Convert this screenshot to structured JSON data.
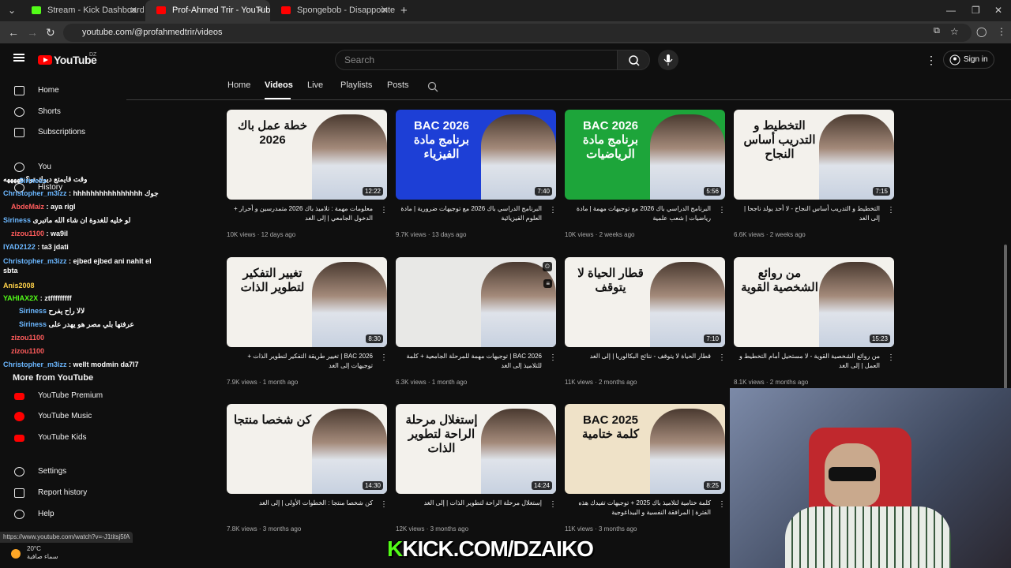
{
  "browser": {
    "tabs": [
      {
        "title": "Stream - Kick Dashboard",
        "color": "#53fc18",
        "active": false
      },
      {
        "title": "Prof-Ahmed Trir - YouTube",
        "color": "#ff0000",
        "active": true
      },
      {
        "title": "Spongebob - Disappointed So",
        "color": "#ff0000",
        "active": false
      }
    ],
    "url": "youtube.com/@profahmedtrir/videos",
    "new_tab": "+",
    "tab_close": "✕"
  },
  "header": {
    "logo": "YouTube",
    "country": "DZ",
    "search_placeholder": "Search",
    "sign_in": "Sign in"
  },
  "sidebar": {
    "items": [
      {
        "label": "Home",
        "icon": "home-icon"
      },
      {
        "label": "Shorts",
        "icon": "shorts-icon"
      },
      {
        "label": "Subscriptions",
        "icon": "subscriptions-icon"
      },
      {
        "label": "You",
        "icon": "you-icon"
      },
      {
        "label": "History",
        "icon": "history-icon"
      }
    ],
    "more_title": "More from YouTube",
    "more": [
      {
        "label": "YouTube Premium",
        "icon": "youtube-premium-icon"
      },
      {
        "label": "YouTube Music",
        "icon": "youtube-music-icon"
      },
      {
        "label": "YouTube Kids",
        "icon": "youtube-kids-icon"
      }
    ],
    "footer": [
      {
        "label": "Settings",
        "icon": "settings-icon"
      },
      {
        "label": "Report history",
        "icon": "flag-icon"
      },
      {
        "label": "Help",
        "icon": "help-icon"
      }
    ]
  },
  "chat": [
    {
      "user": "",
      "msg": "وقت قايمتع ديوك تو؟ هههههه"
    },
    {
      "user": "Siriness",
      "msg": ""
    },
    {
      "user": "Christopher_m3izz",
      "msg": ": hhhhhhhhhhhhhhhh جوك"
    },
    {
      "user": "AbdeMaiz",
      "msg": ": aya rigl"
    },
    {
      "user": "Siriness",
      "msg": "لو خليه للغدوة ان شاء الله ماتبرى"
    },
    {
      "user": "zizou1100",
      "msg": ": wa9il"
    },
    {
      "user": "IYAD2122",
      "msg": ": ta3 jdati"
    },
    {
      "user": "Christopher_m3izz",
      "msg": ": ejbed ejbed ani nahit el sbta"
    },
    {
      "user": "Anis2008",
      "msg": ""
    },
    {
      "user": "YAHIAX2X",
      "msg": ": ztfffffffff"
    },
    {
      "user": "Siriness",
      "msg": "لالا راح يفرح"
    },
    {
      "user": "Siriness",
      "msg": "عرفتها بلي مصر هو يهدر على"
    },
    {
      "user": "zizou1100",
      "msg": ""
    },
    {
      "user": "zizou1100",
      "msg": ""
    },
    {
      "user": "Christopher_m3izz",
      "msg": ": wellt modmin da7l7"
    }
  ],
  "channel_tabs": [
    "Home",
    "Videos",
    "Live",
    "Playlists",
    "Posts"
  ],
  "videos": [
    {
      "thumb_text": "خطة عمل باك 2026",
      "duration": "12:22",
      "title": "معلومات مهمة : تلاميذ باك 2026 متمدرسين و أحرار + الدخول الجامعي | إلى الغد",
      "views": "10K views",
      "age": "12 days ago",
      "bg": "#f3f1ec"
    },
    {
      "thumb_text": "BAC 2026 برنامج مادة الفيزياء",
      "duration": "7:40",
      "title": "البرنامج الدراسي باك 2026 مع توجيهات ضرورية | مادة العلوم الفيزيائية",
      "views": "9.7K views",
      "age": "13 days ago",
      "bg": "#1d3fd6"
    },
    {
      "thumb_text": "BAC 2026 برنامج مادة الرياضيات",
      "duration": "5:56",
      "title": "البرنامج الدراسي باك 2026 مع توجيهات مهمة | مادة رياضيات | شعب علمية",
      "views": "10K views",
      "age": "2 weeks ago",
      "bg": "#1da53a"
    },
    {
      "thumb_text": "التخطيط و التدريب أساس النجاح",
      "duration": "7:15",
      "title": "التخطيط و التدريب أساس النجاح - لا أحد يولد ناجحا | إلى الغد",
      "views": "6.6K views",
      "age": "2 weeks ago",
      "bg": "#f3f1ec"
    },
    {
      "thumb_text": "تغيير التفكير لتطوير الذات",
      "duration": "8:30",
      "title": "BAC 2026 | تغيير طريقة التفكير لتطوير الذات + توجيهات إلى الغد",
      "views": "7.9K views",
      "age": "1 month ago",
      "bg": "#f3f1ec"
    },
    {
      "thumb_text": "",
      "duration": "",
      "title": "BAC 2026 | توجيهات مهمة للمرحلة الجامعية + كلمة للتلاميذ إلى الغد",
      "views": "6.3K views",
      "age": "1 month ago",
      "bg": "#e8e8e6"
    },
    {
      "thumb_text": "قطار الحياة لا يتوقف",
      "duration": "7:10",
      "title": "قطار الحياة لا يتوقف - نتائج البكالوريا | إلى الغد",
      "views": "11K views",
      "age": "2 months ago",
      "bg": "#f3f1ec"
    },
    {
      "thumb_text": "من روائع الشخصية القوية",
      "duration": "15:23",
      "title": "من روائع الشخصية القوية - لا مستحيل أمام التخطيط و العمل | إلى الغد",
      "views": "8.1K views",
      "age": "2 months ago",
      "bg": "#f3f1ec"
    },
    {
      "thumb_text": "كن شخصا منتجا",
      "duration": "14:30",
      "title": "كن شخصا منتجا : الخطوات الأولى | إلى الغد",
      "views": "7.8K views",
      "age": "3 months ago",
      "bg": "#f3f1ec"
    },
    {
      "thumb_text": "إستغلال مرحلة الراحة لتطوير الذات",
      "duration": "14:24",
      "title": "إستغلال مرحلة الراحة لتطوير الذات | إلى الغد",
      "views": "12K views",
      "age": "3 months ago",
      "bg": "#f3f1ec"
    },
    {
      "thumb_text": "BAC 2025 كلمة ختامية",
      "duration": "8:25",
      "title": "كلمة ختامية لتلاميذ باك 2025 + توجيهات تفيدك هذه الفترة | المرافقة النفسية و البيداغوجية",
      "views": "11K views",
      "age": "3 months ago",
      "bg": "#efe2c8"
    }
  ],
  "status_url": "https://www.youtube.com/watch?v=-J1titsj5fA",
  "weather": {
    "temp": "20°C",
    "desc": "سماء صافية"
  },
  "overlay": {
    "k": "K",
    "rest": "KICK.COM/DZAIKO"
  }
}
